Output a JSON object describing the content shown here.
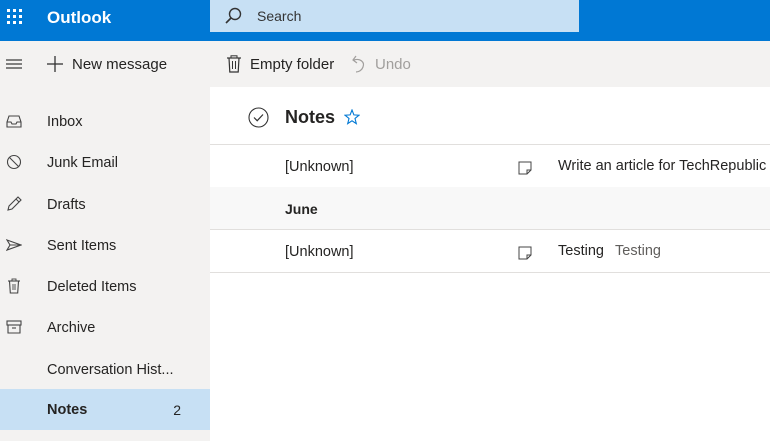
{
  "header": {
    "app_name": "Outlook",
    "search_placeholder": "Search"
  },
  "commands": {
    "new_message": "New message",
    "empty_folder": "Empty folder",
    "undo": "Undo"
  },
  "nav": {
    "items": [
      {
        "label": "Inbox",
        "icon": "inbox-icon"
      },
      {
        "label": "Junk Email",
        "icon": "block-icon"
      },
      {
        "label": "Drafts",
        "icon": "pencil-icon"
      },
      {
        "label": "Sent Items",
        "icon": "send-icon"
      },
      {
        "label": "Deleted Items",
        "icon": "trash-icon"
      },
      {
        "label": "Archive",
        "icon": "archive-icon"
      },
      {
        "label": "Conversation Hist...",
        "icon": ""
      },
      {
        "label": "Notes",
        "icon": "",
        "count": "2",
        "selected": true
      }
    ]
  },
  "list": {
    "folder_title": "Notes",
    "groups": [
      {
        "label": "June"
      }
    ],
    "messages": [
      {
        "from": "[Unknown]",
        "subject": "Write an article for TechRepublic",
        "preview": ""
      },
      {
        "from": "[Unknown]",
        "subject": "Testing",
        "preview": "Testing"
      }
    ]
  },
  "colors": {
    "brand_blue": "#0078d4",
    "search_bg": "#c7e0f4",
    "selected_bg": "#c7e0f4",
    "pane_bg": "#f3f2f1"
  }
}
